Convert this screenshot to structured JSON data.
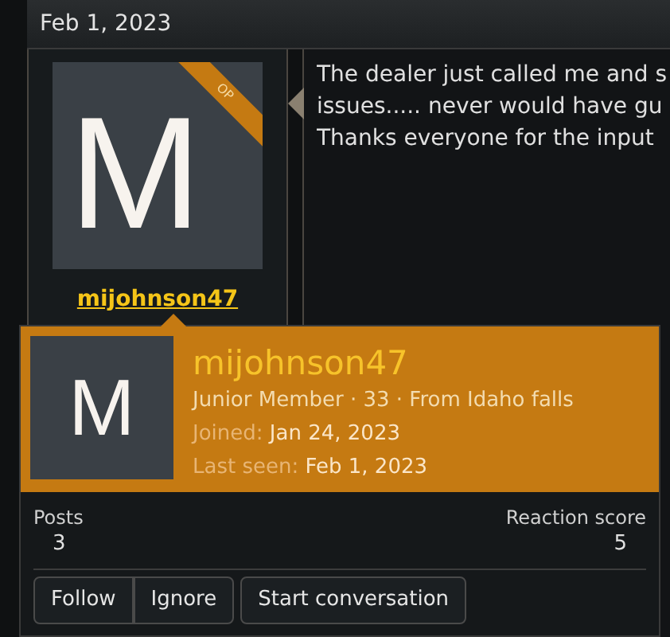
{
  "date_bar": {
    "date": "Feb 1, 2023"
  },
  "post": {
    "avatar_letter": "M",
    "badge": "OP",
    "username": "mijohnson47",
    "message_lines": [
      "The dealer just called me and s",
      "issues..... never would have gu",
      "Thanks everyone for the input"
    ]
  },
  "member_tooltip": {
    "avatar_letter": "M",
    "username": "mijohnson47",
    "blurb": "Junior Member · 33 · From Idaho falls",
    "facts": [
      {
        "label": "Joined:",
        "value": "Jan 24, 2023"
      },
      {
        "label": "Last seen:",
        "value": "Feb 1, 2023"
      }
    ],
    "stats": [
      {
        "label": "Posts",
        "value": "3"
      },
      {
        "label": "Reaction score",
        "value": "5"
      }
    ],
    "button_groups": [
      [
        "Follow",
        "Ignore"
      ],
      [
        "Start conversation"
      ]
    ]
  }
}
